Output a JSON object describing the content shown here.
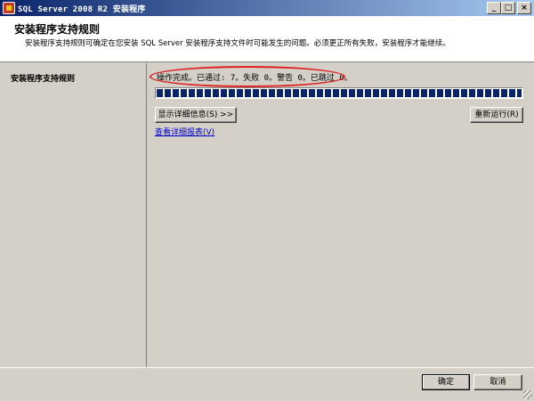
{
  "window": {
    "title": "SQL Server 2008 R2 安装程序",
    "minimize": "_",
    "maximize": "□",
    "close": "×"
  },
  "header": {
    "title": "安装程序支持规则",
    "description": "安装程序支持规则可确定在您安装 SQL Server 安装程序支持文件时可能发生的问题。必须更正所有失败，安装程序才能继续。"
  },
  "sidebar": {
    "items": [
      {
        "label": "安装程序支持规则"
      }
    ]
  },
  "content": {
    "status": "操作完成。已通过: 7。失败 0。警告 0。已跳过 0。",
    "progress": 1.0,
    "show_details_label": "显示详细信息(S) >>",
    "rerun_label": "重新运行(R)",
    "view_report_label": "查看详细报表(V)"
  },
  "footer": {
    "ok_label": "确定",
    "cancel_label": "取消"
  },
  "colors": {
    "titlebar_start": "#0a246a",
    "titlebar_end": "#a6caf0",
    "progress_fill": "#0a246a",
    "annotation": "#dd2222",
    "link": "#0000cc"
  },
  "icons": [
    "app-icon"
  ]
}
